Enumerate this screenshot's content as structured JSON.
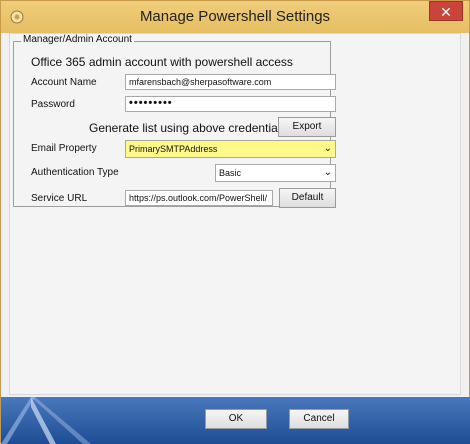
{
  "window": {
    "title": "Manage Powershell Settings",
    "close_glyph": "✕"
  },
  "group": {
    "legend": "Manager/Admin Account",
    "description": "Office 365 admin account with powershell access"
  },
  "account": {
    "label": "Account Name",
    "value": "mfarensbach@sherpasoftware.com"
  },
  "password": {
    "label": "Password",
    "value": "•••••••••"
  },
  "generate": {
    "text": "Generate list using above credentials:",
    "export_label": "Export"
  },
  "email": {
    "label": "Email Property",
    "value": "PrimarySMTPAddress",
    "highlight_color": "#fff98a"
  },
  "auth": {
    "label": "Authentication Type",
    "value": "Basic"
  },
  "service": {
    "label": "Service URL",
    "value": "https://ps.outlook.com/PowerShell/",
    "default_label": "Default"
  },
  "footer": {
    "ok_label": "OK",
    "cancel_label": "Cancel"
  },
  "icons": {
    "app": "gear-app-icon",
    "dropdown": "chevron-down-icon",
    "logo": "compass-logo"
  }
}
